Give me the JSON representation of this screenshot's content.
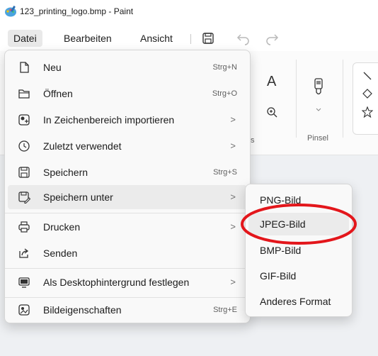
{
  "window": {
    "title": "123_printing_logo.bmp - Paint"
  },
  "menubar": {
    "items": [
      "Datei",
      "Bearbeiten",
      "Ansicht"
    ]
  },
  "ribbon": {
    "brushes_label": "Pinsel",
    "partial_label": "s",
    "text_tool_glyph": "A"
  },
  "file_menu": {
    "items": [
      {
        "label": "Neu",
        "shortcut": "Strg+N",
        "icon": "new-file-icon"
      },
      {
        "label": "Öffnen",
        "shortcut": "Strg+O",
        "icon": "folder-icon"
      },
      {
        "label": "In Zeichenbereich importieren",
        "submenu_arrow": ">",
        "icon": "import-image-icon"
      },
      {
        "label": "Zuletzt verwendet",
        "submenu_arrow": ">",
        "icon": "clock-icon"
      },
      {
        "label": "Speichern",
        "shortcut": "Strg+S",
        "icon": "save-icon"
      },
      {
        "label": "Speichern unter",
        "submenu_arrow": ">",
        "icon": "save-as-icon"
      },
      {
        "label": "Drucken",
        "submenu_arrow": ">",
        "icon": "printer-icon"
      },
      {
        "label": "Senden",
        "icon": "share-icon"
      },
      {
        "label": "Als Desktophintergrund festlegen",
        "submenu_arrow": ">",
        "icon": "desktop-background-icon"
      },
      {
        "label": "Bildeigenschaften",
        "shortcut": "Strg+E",
        "icon": "image-properties-icon"
      }
    ]
  },
  "save_as_submenu": {
    "items": [
      "PNG-Bild",
      "JPEG-Bild",
      "BMP-Bild",
      "GIF-Bild",
      "Anderes Format"
    ]
  },
  "colors": {
    "highlight_ellipse": "#e3161b",
    "menu_bg": "#f9f9f9",
    "hover_bg": "#ebebeb"
  }
}
